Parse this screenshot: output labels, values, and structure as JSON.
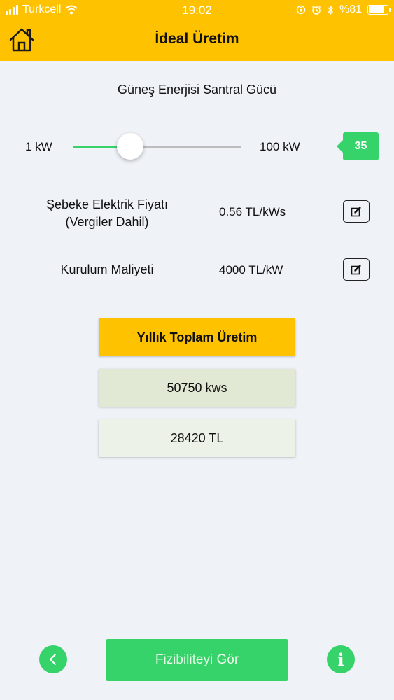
{
  "status_bar": {
    "carrier": "Turkcell",
    "time": "19:02",
    "battery_text": "%81",
    "battery_level": 0.81
  },
  "header": {
    "title": "İdeal Üretim",
    "home_icon": "home-icon"
  },
  "power": {
    "title": "Güneş Enerjisi Santral Gücü",
    "min_label": "1 kW",
    "max_label": "100 kW",
    "min": 1,
    "max": 100,
    "value": 35,
    "value_text": "35"
  },
  "electricity_price": {
    "label_line1": "Şebeke Elektrik Fiyatı",
    "label_line2": "(Vergiler Dahil)",
    "value": "0.56 TL/kWs",
    "edit_icon": "edit-icon"
  },
  "installation_cost": {
    "label": "Kurulum Maliyeti",
    "value": "4000 TL/kW",
    "edit_icon": "edit-icon"
  },
  "results": {
    "header": "Yıllık Toplam Üretim",
    "production": "50750 kws",
    "amount": "28420 TL"
  },
  "footer": {
    "back_icon": "chevron-left-icon",
    "primary_button": "Fizibiliteyi Gör",
    "info_text": "i"
  },
  "colors": {
    "accent_yellow": "#ffc200",
    "accent_green": "#36d26a",
    "background": "#eff2f7",
    "production_card": "#e1e9d5",
    "amount_card": "#edf2e9"
  }
}
